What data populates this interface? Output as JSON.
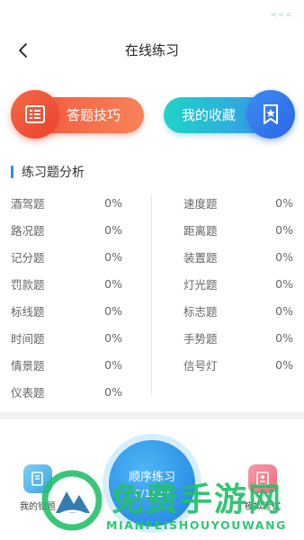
{
  "status_bar": {
    "indicator_text": "<<<"
  },
  "nav": {
    "title": "在线练习"
  },
  "actions": {
    "tips_label": "答题技巧",
    "favorites_label": "我的收藏"
  },
  "section": {
    "title": "练习题分析"
  },
  "stats": {
    "left": [
      {
        "name": "酒驾题",
        "value": "0%"
      },
      {
        "name": "路况题",
        "value": "0%"
      },
      {
        "name": "记分题",
        "value": "0%"
      },
      {
        "name": "罚款题",
        "value": "0%"
      },
      {
        "name": "标线题",
        "value": "0%"
      },
      {
        "name": "时间题",
        "value": "0%"
      },
      {
        "name": "情景题",
        "value": "0%"
      },
      {
        "name": "仪表题",
        "value": "0%"
      }
    ],
    "right": [
      {
        "name": "速度题",
        "value": "0%"
      },
      {
        "name": "距离题",
        "value": "0%"
      },
      {
        "name": "装置题",
        "value": "0%"
      },
      {
        "name": "灯光题",
        "value": "0%"
      },
      {
        "name": "标志题",
        "value": "0%"
      },
      {
        "name": "手势题",
        "value": "0%"
      },
      {
        "name": "信号灯",
        "value": "0%"
      }
    ]
  },
  "bottom": {
    "left_label": "我的错题",
    "center_title": "顺序练习",
    "center_progress": "0/1129",
    "right_label": "模拟考试"
  },
  "watermark": {
    "text": "免费手游网",
    "sub": "MIANFEISHOUYOUWANG"
  },
  "colors": {
    "tips_gradient": [
      "#f0563c",
      "#f9825a"
    ],
    "favorites_gradient": [
      "#1fd4c6",
      "#3a8ef0"
    ],
    "accent_blue": "#2d8cf0",
    "watermark_green": "#23c06a"
  }
}
